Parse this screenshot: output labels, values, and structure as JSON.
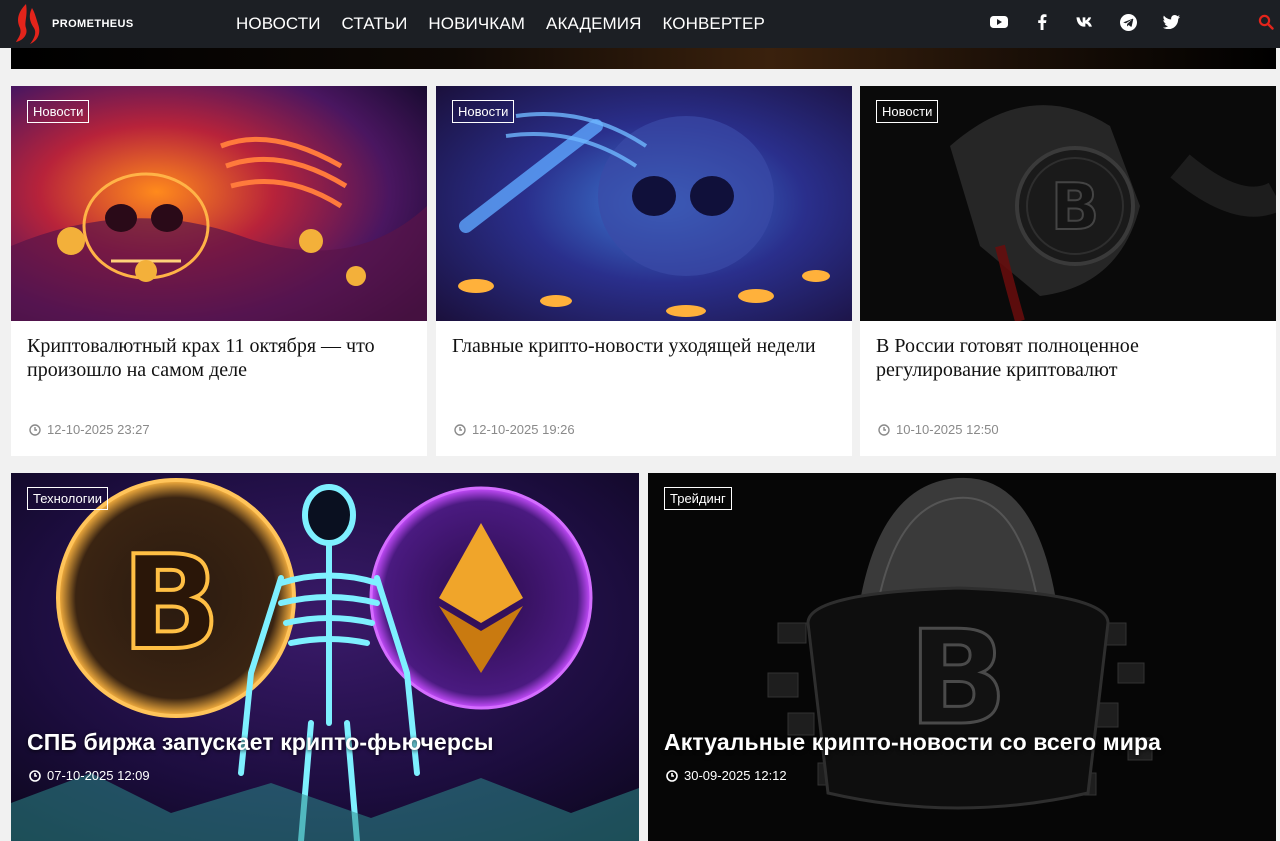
{
  "header": {
    "brand": "PROMETHEUS",
    "brand_color": "#e3241b",
    "nav": [
      "НОВОСТИ",
      "СТАТЬИ",
      "НОВИЧКАМ",
      "АКАДЕМИЯ",
      "КОНВЕРТЕР"
    ],
    "socials": [
      "youtube-icon",
      "facebook-icon",
      "vk-icon",
      "telegram-icon",
      "twitter-icon"
    ],
    "search_icon": "search-icon",
    "accent": "#e3241b"
  },
  "cards": [
    {
      "tag": "Новости",
      "title": "Криптовалютный крах 11 октября — что произошло на самом деле",
      "date": "12-10-2025 23:27"
    },
    {
      "tag": "Новости",
      "title": "Главные крипто-новости уходящей недели",
      "date": "12-10-2025 19:26"
    },
    {
      "tag": "Новости",
      "title": "В России готовят полноценное регулирование криптовалют",
      "date": "10-10-2025 12:50"
    }
  ],
  "featured": [
    {
      "tag": "Технологии",
      "title": "СПБ биржа запускает крипто-фьючерсы",
      "date": "07-10-2025 12:09"
    },
    {
      "tag": "Трейдинг",
      "title": "Актуальные крипто-новости со всего мира",
      "date": "30-09-2025 12:12"
    }
  ]
}
